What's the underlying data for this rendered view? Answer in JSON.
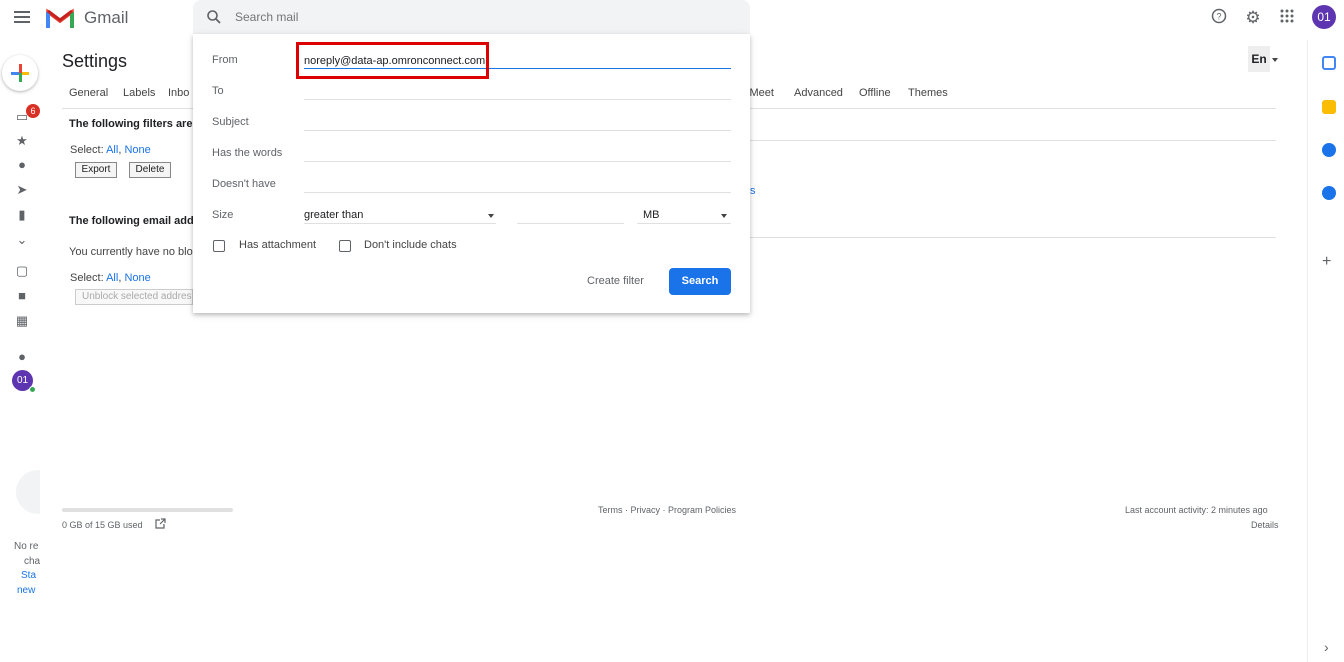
{
  "app": {
    "name": "Gmail",
    "avatar": "01"
  },
  "search": {
    "placeholder": "Search mail"
  },
  "left_rail": {
    "badge": "6",
    "avatar": "01"
  },
  "settings": {
    "title": "Settings",
    "language": "En",
    "tabs": [
      "General",
      "Labels",
      "Inbo",
      "l Meet",
      "Advanced",
      "Offline",
      "Themes"
    ],
    "filters_heading": "The following filters are a",
    "select_label": "Select:",
    "select_all": "All",
    "select_none": "None",
    "export_btn": "Export",
    "delete_btn": "Delete",
    "blocked_heading": "The following email addr",
    "blocked_text": "You currently have no blo",
    "unblock_btn": "Unblock selected addres",
    "cut_link": "s"
  },
  "dialog": {
    "from_label": "From",
    "from_value": "noreply@data-ap.omronconnect.com",
    "to_label": "To",
    "subject_label": "Subject",
    "has_words_label": "Has the words",
    "doesnt_have_label": "Doesn't have",
    "size_label": "Size",
    "size_op": "greater than",
    "size_unit": "MB",
    "has_attachment": "Has attachment",
    "dont_include_chats": "Don't include chats",
    "create_filter": "Create filter",
    "search_btn": "Search"
  },
  "footer": {
    "storage": "0 GB of 15 GB used",
    "links": "Terms · Privacy · Program Policies",
    "activity": "Last account activity: 2 minutes ago",
    "details": "Details"
  },
  "chat_panel": {
    "line1": "No re",
    "line2": "cha",
    "line3": "Sta",
    "line4": "new"
  },
  "colors": {
    "accent": "#1a73e8",
    "highlight": "#dd0000",
    "avatar": "#5e35b1"
  }
}
